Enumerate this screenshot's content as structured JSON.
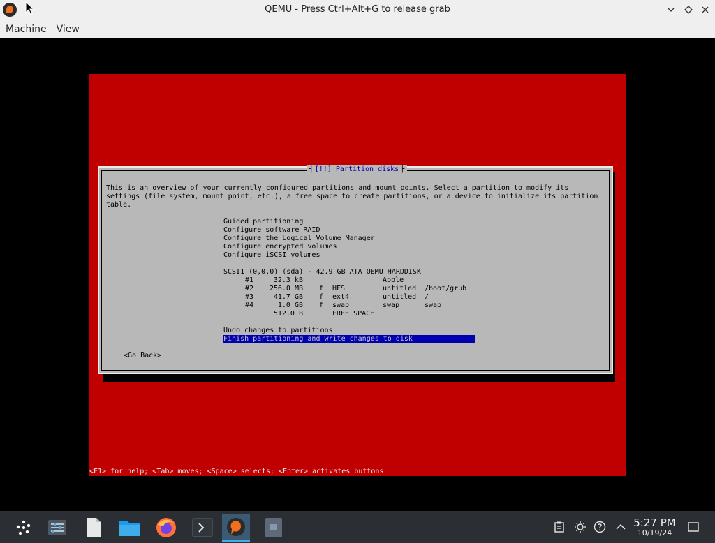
{
  "window": {
    "title": "QEMU - Press Ctrl+Alt+G to release grab",
    "controls": [
      "minimize",
      "maximize",
      "close"
    ]
  },
  "menu": {
    "machine": "Machine",
    "view": "View"
  },
  "installer": {
    "dialog_title": "[!!] Partition disks",
    "intro": "This is an overview of your currently configured partitions and mount points. Select a partition to modify its settings (file system, mount point, etc.), a free space to create partitions, or a device to initialize its partition table.",
    "options": [
      "Guided partitioning",
      "Configure software RAID",
      "Configure the Logical Volume Manager",
      "Configure encrypted volumes",
      "Configure iSCSI volumes"
    ],
    "disk": "SCSI1 (0,0,0) (sda) - 42.9 GB ATA QEMU HARDDISK",
    "partitions": [
      {
        "num": "#1",
        "size": "32.3 kB",
        "flag": "",
        "fs": "",
        "name": "Apple",
        "mount": ""
      },
      {
        "num": "#2",
        "size": "256.0 MB",
        "flag": "f",
        "fs": "HFS",
        "name": "untitled",
        "mount": "/boot/grub"
      },
      {
        "num": "#3",
        "size": "41.7 GB",
        "flag": "f",
        "fs": "ext4",
        "name": "untitled",
        "mount": "/"
      },
      {
        "num": "#4",
        "size": "1.0 GB",
        "flag": "f",
        "fs": "swap",
        "name": "swap",
        "mount": "swap"
      },
      {
        "num": "",
        "size": "512.0 B",
        "flag": "",
        "fs": "FREE SPACE",
        "name": "",
        "mount": ""
      }
    ],
    "undo": "Undo changes to partitions",
    "finish": "Finish partitioning and write changes to disk",
    "go_back": "<Go Back>",
    "help_line": "<F1> for help; <Tab> moves; <Space> selects; <Enter> activates buttons"
  },
  "taskbar": {
    "apps": [
      "application-launcher-icon",
      "system-settings-icon",
      "text-document-icon",
      "file-manager-icon",
      "firefox-icon",
      "terminal-icon",
      "qemu-icon",
      "disk-image-icon"
    ],
    "time": "5:27 PM",
    "date": "10/19/24"
  }
}
